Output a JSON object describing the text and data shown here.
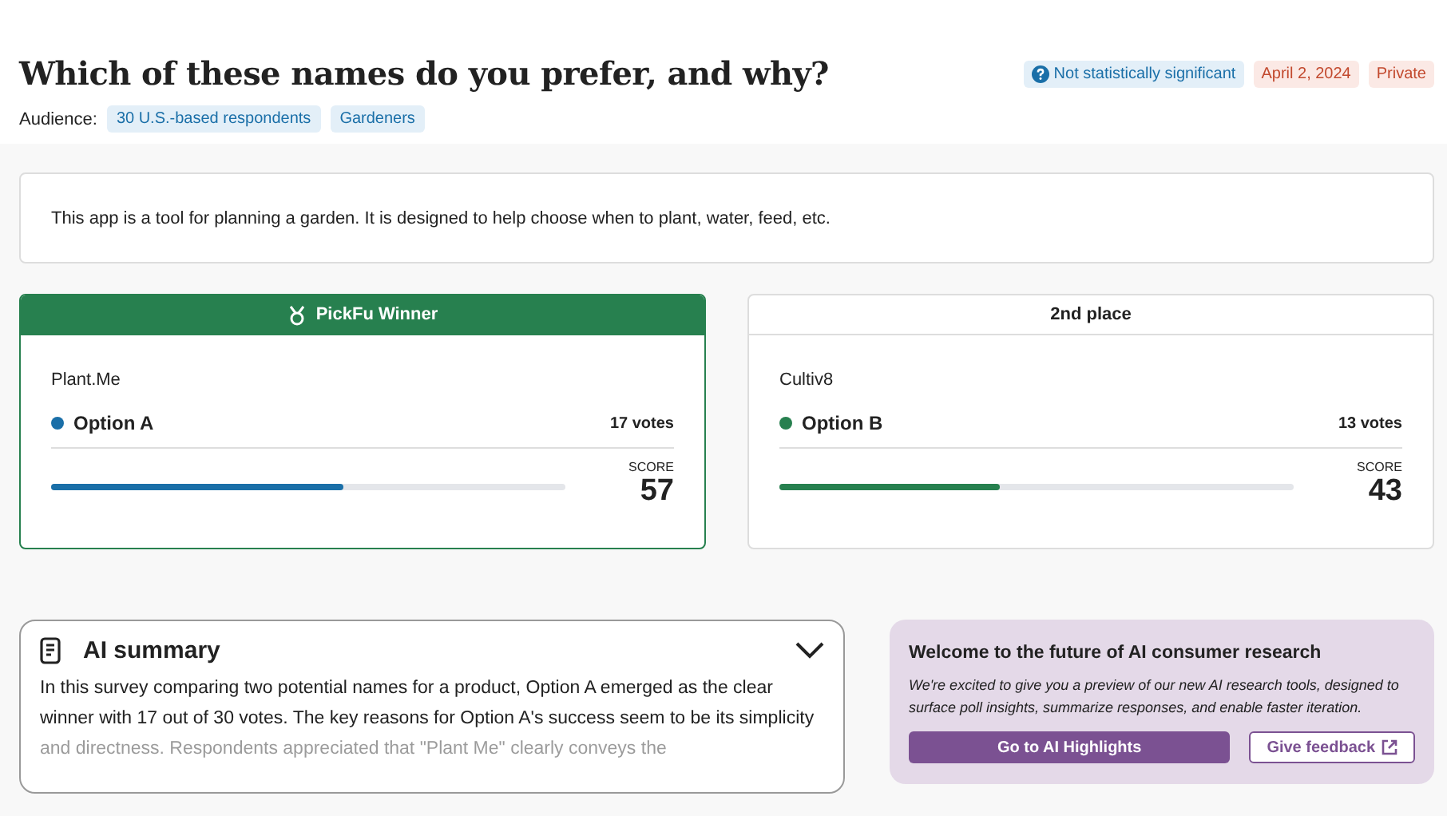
{
  "title": "Which of these names do you prefer, and why?",
  "audience": {
    "label": "Audience:",
    "tags": [
      "30 U.S.-based respondents",
      "Gardeners"
    ]
  },
  "badges": [
    {
      "kind": "info",
      "text": "Not statistically significant"
    },
    {
      "kind": "warn",
      "text": "April 2, 2024"
    },
    {
      "kind": "warn",
      "text": "Private"
    }
  ],
  "description": "This app is a tool for planning a garden. It is designed to help choose when to plant, water, feed, etc.",
  "options": [
    {
      "winner": true,
      "header": "PickFu Winner",
      "name": "Plant.Me",
      "label": "Option A",
      "color": "#1a6fa8",
      "votes": "17 votes",
      "score_label": "SCORE",
      "score": "57",
      "level": 0.57
    },
    {
      "winner": false,
      "header": "2nd place",
      "name": "Cultiv8",
      "label": "Option B",
      "color": "#27804f",
      "votes": "13 votes",
      "score_label": "SCORE",
      "score": "43",
      "level": 0.43
    }
  ],
  "summary": {
    "title": "AI summary",
    "expanded": false,
    "text": "In this survey comparing two potential names for a product, Option A emerged as the clear winner with 17 out of 30 votes. The key reasons for Option A's success seem to be its simplicity and directness. Respondents appreciated that \"Plant Me\" clearly conveys the"
  },
  "promo": {
    "title": "Welcome to the future of AI consumer research",
    "text": "We're excited to give you a preview of our new AI research tools, designed to surface poll insights, summarize responses, and enable faster iteration.",
    "buttons": [
      {
        "kind": "primary",
        "label": "Go to AI Highlights"
      },
      {
        "kind": "outline",
        "label": "Give feedback"
      }
    ]
  }
}
